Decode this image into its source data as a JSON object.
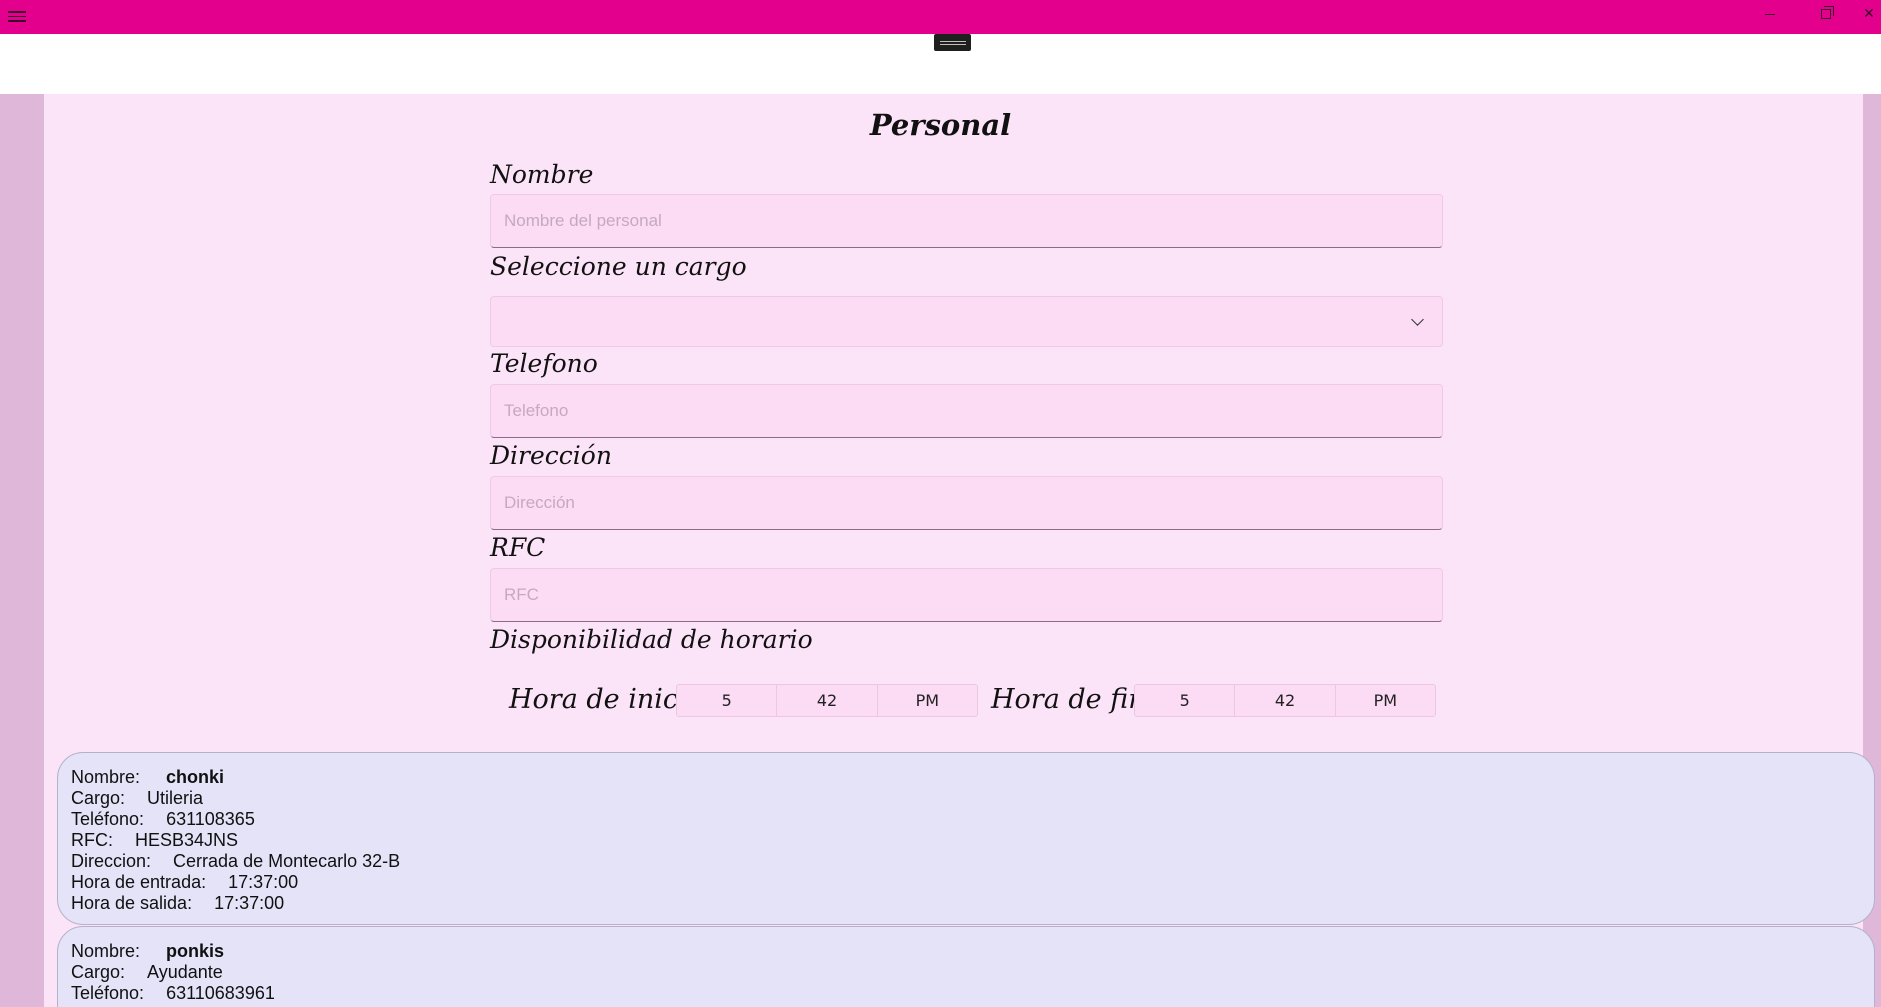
{
  "window": {
    "menu_icon": "hamburger-icon",
    "minimize_icon": "minimize-icon",
    "maximize_icon": "restore-icon",
    "close_icon": "close-icon",
    "close_glyph": "✕",
    "accent_color": "#e3008c"
  },
  "form": {
    "title": "Personal",
    "nombre": {
      "label": "Nombre",
      "placeholder": "Nombre del personal",
      "value": ""
    },
    "cargo": {
      "label": "Seleccione un cargo",
      "value": ""
    },
    "telefono": {
      "label": "Telefono",
      "placeholder": "Telefono",
      "value": ""
    },
    "direccion": {
      "label": "Dirección",
      "placeholder": "Dirección",
      "value": ""
    },
    "rfc": {
      "label": "RFC",
      "placeholder": "RFC",
      "value": ""
    },
    "disponibilidad": {
      "label": "Disponibilidad de horario",
      "inicio": {
        "label": "Hora de inicio",
        "hour": "5",
        "minute": "42",
        "period": "PM"
      },
      "fin": {
        "label": "Hora de fin",
        "hour": "5",
        "minute": "42",
        "period": "PM"
      }
    }
  },
  "records": [
    {
      "nombre_k": "Nombre:",
      "nombre": "chonki",
      "cargo_k": "Cargo:",
      "cargo": "Utileria",
      "telefono_k": "Teléfono:",
      "telefono": "631108365",
      "rfc_k": "RFC:",
      "rfc": "HESB34JNS",
      "direccion_k": "Direccion:",
      "direccion": "Cerrada de Montecarlo 32-B",
      "entrada_k": "Hora de entrada:",
      "entrada": "17:37:00",
      "salida_k": "Hora de salida:",
      "salida": "17:37:00"
    },
    {
      "nombre_k": "Nombre:",
      "nombre": "ponkis",
      "cargo_k": "Cargo:",
      "cargo": "Ayudante",
      "telefono_k": "Teléfono:",
      "telefono": "63110683961"
    }
  ]
}
